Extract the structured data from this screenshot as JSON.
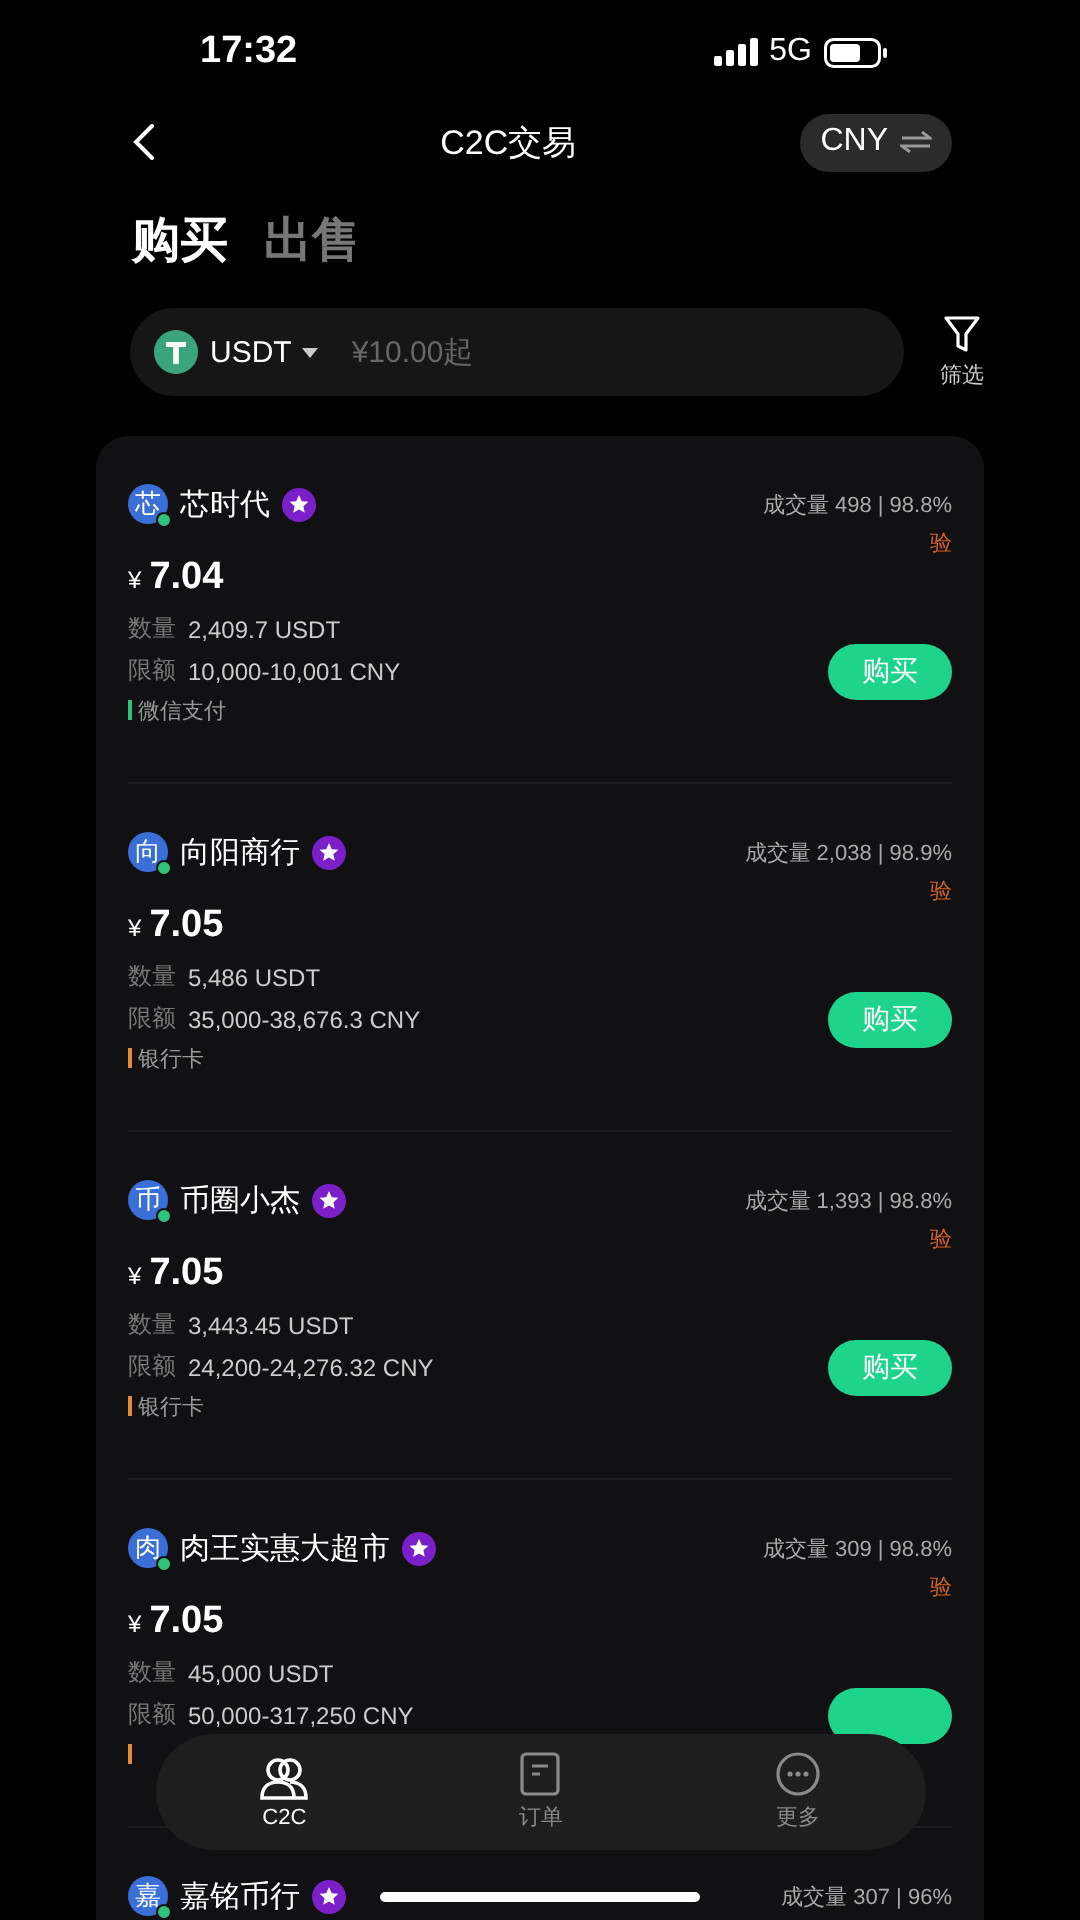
{
  "status_bar": {
    "time": "17:32",
    "network": "5G"
  },
  "header": {
    "title": "C2C交易",
    "currency": "CNY"
  },
  "tabs": [
    {
      "label": "购买",
      "selected": true
    },
    {
      "label": "出售",
      "selected": false
    }
  ],
  "search": {
    "coin": "USDT",
    "placeholder": "¥10.00起"
  },
  "filter": {
    "label": "筛选"
  },
  "offers": [
    {
      "avatar": "芯",
      "name": "芯时代",
      "stats": "成交量 498 | 98.8%",
      "verify": "验",
      "currency_sign": "¥",
      "price": "7.04",
      "quantity_label": "数量",
      "quantity": "2,409.7 USDT",
      "limit_label": "限额",
      "limit": "10,000-10,001 CNY",
      "payment": {
        "label": "微信支付",
        "color": "#2fc27a"
      },
      "button": "购买"
    },
    {
      "avatar": "向",
      "name": "向阳商行",
      "stats": "成交量 2,038 | 98.9%",
      "verify": "验",
      "currency_sign": "¥",
      "price": "7.05",
      "quantity_label": "数量",
      "quantity": "5,486 USDT",
      "limit_label": "限额",
      "limit": "35,000-38,676.3 CNY",
      "payment": {
        "label": "银行卡",
        "color": "#e88a3a"
      },
      "button": "购买"
    },
    {
      "avatar": "币",
      "name": "币圈小杰",
      "stats": "成交量 1,393 | 98.8%",
      "verify": "验",
      "currency_sign": "¥",
      "price": "7.05",
      "quantity_label": "数量",
      "quantity": "3,443.45 USDT",
      "limit_label": "限额",
      "limit": "24,200-24,276.32 CNY",
      "payment": {
        "label": "银行卡",
        "color": "#e88a3a"
      },
      "button": "购买"
    },
    {
      "avatar": "肉",
      "name": "肉王实惠大超市",
      "stats": "成交量 309 | 98.8%",
      "verify": "验",
      "currency_sign": "¥",
      "price": "7.05",
      "quantity_label": "数量",
      "quantity": "45,000 USDT",
      "limit_label": "限额",
      "limit": "50,000-317,250 CNY",
      "payment": {
        "color": "#e88a3a"
      }
    },
    {
      "avatar": "嘉",
      "name": "嘉铭币行",
      "stats": "成交量 307 | 96%"
    }
  ],
  "nav": [
    {
      "kind": "people",
      "label": "C2C",
      "selected": true
    },
    {
      "kind": "orders",
      "label": "订单",
      "selected": false
    },
    {
      "kind": "more",
      "label": "更多",
      "selected": false
    }
  ]
}
